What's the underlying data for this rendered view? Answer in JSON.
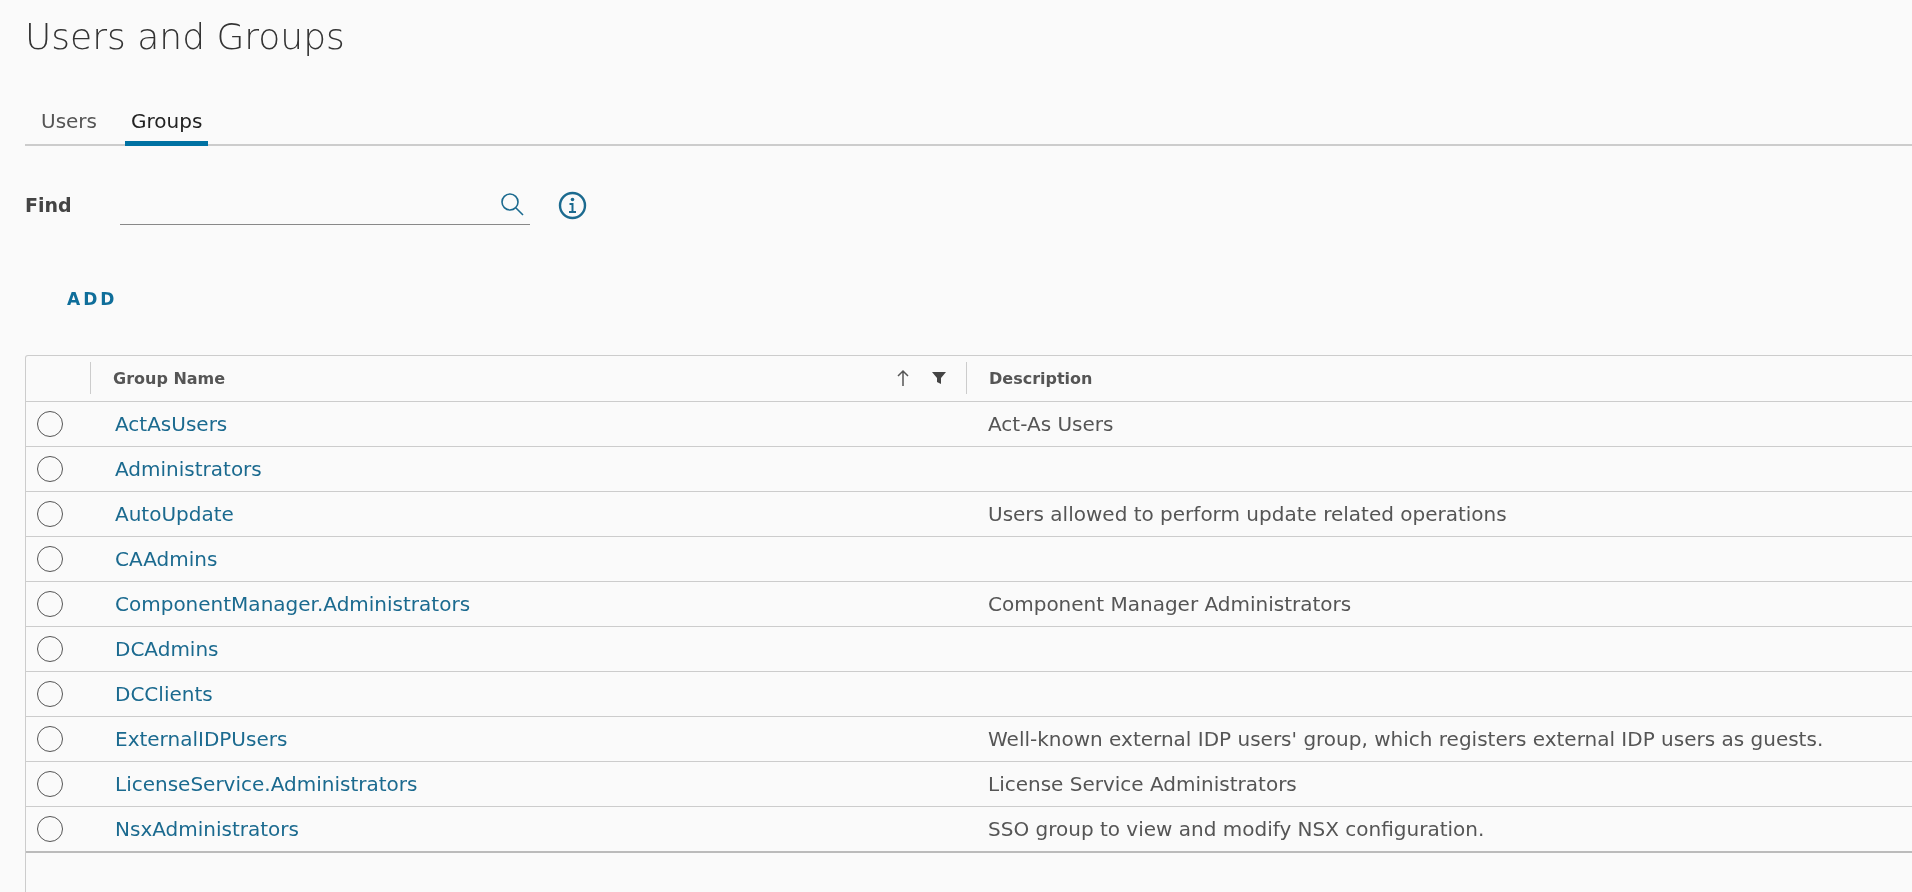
{
  "page": {
    "title": "Users and Groups"
  },
  "tabs": [
    {
      "label": "Users",
      "selected": false
    },
    {
      "label": "Groups",
      "selected": true
    }
  ],
  "find": {
    "label": "Find"
  },
  "toolbar": {
    "add_label": "ADD"
  },
  "table": {
    "columns": [
      {
        "label": "Group Name",
        "sorted_ascending": true,
        "filter": true
      },
      {
        "label": "Description"
      }
    ],
    "rows": [
      {
        "name": "ActAsUsers",
        "description": "Act-As Users",
        "selected": false
      },
      {
        "name": "Administrators",
        "selected": false
      },
      {
        "name": "AutoUpdate",
        "description": "Users allowed to perform update related operations",
        "selected": false
      },
      {
        "name": "CAAdmins",
        "selected": false
      },
      {
        "name": "ComponentManager.Administrators",
        "description": "Component Manager Administrators",
        "selected": false
      },
      {
        "name": "DCAdmins",
        "selected": false
      },
      {
        "name": "DCClients",
        "selected": false
      },
      {
        "name": "ExternalIDPUsers",
        "description": "Well-known external IDP users' group, which registers external IDP users as guests.",
        "selected": false
      },
      {
        "name": "LicenseService.Administrators",
        "description": "License Service Administrators",
        "selected": false
      },
      {
        "name": "NsxAdministrators",
        "description": "SSO group to view and modify NSX configuration.",
        "selected": false
      }
    ]
  }
}
